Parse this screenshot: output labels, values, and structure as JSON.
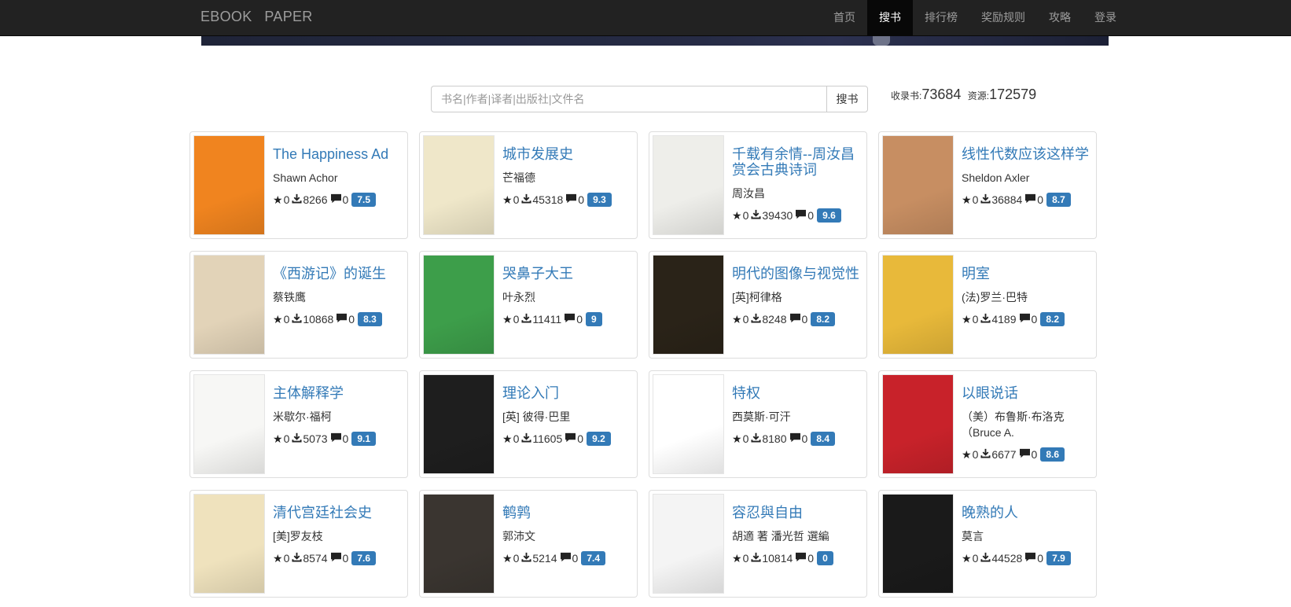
{
  "nav": {
    "brand": "EBOOK   PAPER",
    "items": [
      "首页",
      "搜书",
      "排行榜",
      "奖励规则",
      "攻略",
      "登录"
    ],
    "active_index": 1
  },
  "search": {
    "placeholder": "书名|作者|译者|出版社|文件名",
    "button": "搜书"
  },
  "stats": {
    "books_label": "收录书:",
    "books_value": "73684",
    "resources_label": "资源:",
    "resources_value": "172579"
  },
  "colors": {
    "accent": "#337ab7",
    "navbar": "#222222"
  },
  "books": [
    {
      "title": "The Happiness Ad",
      "author": "Shawn Achor",
      "stars": "0",
      "downloads": "8266",
      "comments": "0",
      "score": "7.5",
      "cover": "#f0841f"
    },
    {
      "title": "城市发展史",
      "author": "芒福德",
      "stars": "0",
      "downloads": "45318",
      "comments": "0",
      "score": "9.3",
      "cover": "#efe7c9"
    },
    {
      "title": "千载有余情--周汝昌赏会古典诗词",
      "author": "周汝昌",
      "stars": "0",
      "downloads": "39430",
      "comments": "0",
      "score": "9.6",
      "cover": "#eeeeea"
    },
    {
      "title": "线性代数应该这样学",
      "author": "Sheldon Axler",
      "stars": "0",
      "downloads": "36884",
      "comments": "0",
      "score": "8.7",
      "cover": "#c78e62"
    },
    {
      "title": "《西游记》的诞生",
      "author": "蔡铁鹰",
      "stars": "0",
      "downloads": "10868",
      "comments": "0",
      "score": "8.3",
      "cover": "#e2d3b8"
    },
    {
      "title": "哭鼻子大王",
      "author": "叶永烈",
      "stars": "0",
      "downloads": "11411",
      "comments": "0",
      "score": "9",
      "cover": "#3d9e4a"
    },
    {
      "title": "明代的图像与视觉性",
      "author": "[英]柯律格",
      "stars": "0",
      "downloads": "8248",
      "comments": "0",
      "score": "8.2",
      "cover": "#2a2318"
    },
    {
      "title": "明室",
      "author": "(法)罗兰·巴特",
      "stars": "0",
      "downloads": "4189",
      "comments": "0",
      "score": "8.2",
      "cover": "#e8b93a"
    },
    {
      "title": "主体解释学",
      "author": "米歇尔·福柯",
      "stars": "0",
      "downloads": "5073",
      "comments": "0",
      "score": "9.1",
      "cover": "#f7f7f5"
    },
    {
      "title": "理论入门",
      "author": "[英] 彼得·巴里",
      "stars": "0",
      "downloads": "11605",
      "comments": "0",
      "score": "9.2",
      "cover": "#1e1e1e"
    },
    {
      "title": "特权",
      "author": "西莫斯·可汗",
      "stars": "0",
      "downloads": "8180",
      "comments": "0",
      "score": "8.4",
      "cover": "#ffffff"
    },
    {
      "title": "以眼说话",
      "author": "（美）布鲁斯·布洛克（Bruce A.",
      "stars": "0",
      "downloads": "6677",
      "comments": "0",
      "score": "8.6",
      "cover": "#c8222a"
    },
    {
      "title": "清代宫廷社会史",
      "author": "[美]罗友枝",
      "stars": "0",
      "downloads": "8574",
      "comments": "0",
      "score": "7.6",
      "cover": "#efe2bd"
    },
    {
      "title": "鹌鹑",
      "author": "郭沛文",
      "stars": "0",
      "downloads": "5214",
      "comments": "0",
      "score": "7.4",
      "cover": "#3a3530"
    },
    {
      "title": "容忍與自由",
      "author": "胡適 著 潘光哲 選編",
      "stars": "0",
      "downloads": "10814",
      "comments": "0",
      "score": "0",
      "cover": "#f4f4f4"
    },
    {
      "title": "晚熟的人",
      "author": "莫言",
      "stars": "0",
      "downloads": "44528",
      "comments": "0",
      "score": "7.9",
      "cover": "#1a1a1a"
    }
  ]
}
